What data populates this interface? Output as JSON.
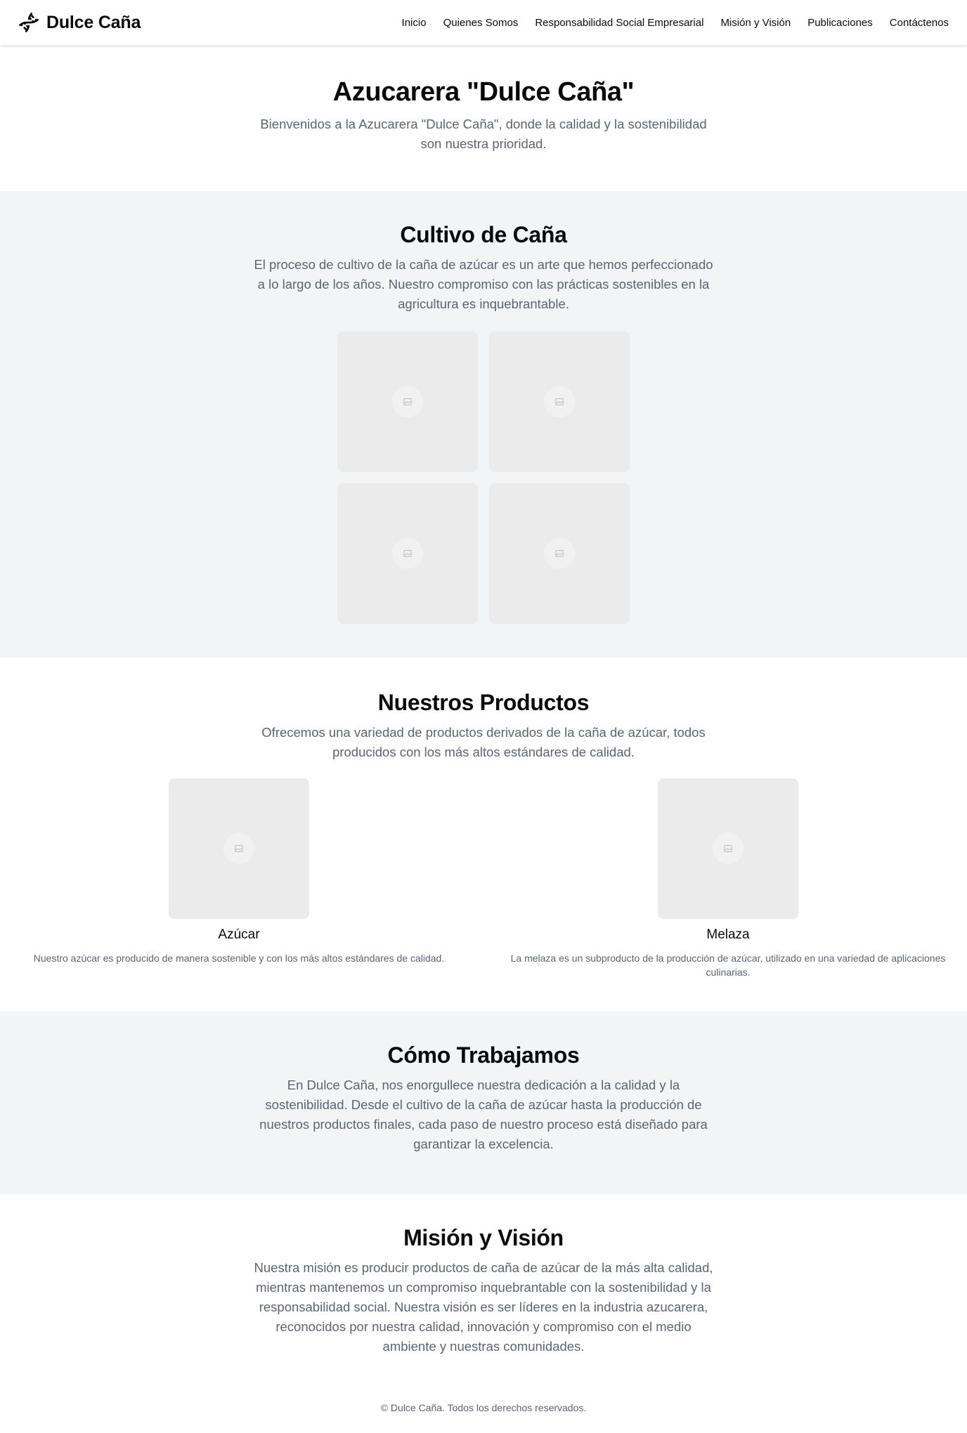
{
  "header": {
    "brand": "Dulce Caña",
    "nav": [
      "Inicio",
      "Quienes Somos",
      "Responsabilidad Social Empresarial",
      "Misión y Visión",
      "Publicaciones",
      "Contáctenos"
    ]
  },
  "hero": {
    "title": "Azucarera \"Dulce Caña\"",
    "text": "Bienvenidos a la Azucarera \"Dulce Caña\", donde la calidad y la sostenibilidad son nuestra prioridad."
  },
  "cultivo": {
    "title": "Cultivo de Caña",
    "text": "El proceso de cultivo de la caña de azúcar es un arte que hemos perfeccionado a lo largo de los años. Nuestro compromiso con las prácticas sostenibles en la agricultura es inquebrantable."
  },
  "productos": {
    "title": "Nuestros Productos",
    "text": "Ofrecemos una variedad de productos derivados de la caña de azúcar, todos producidos con los más altos estándares de calidad.",
    "items": [
      {
        "name": "Azúcar",
        "desc": "Nuestro azúcar es producido de manera sostenible y con los más altos estándares de calidad."
      },
      {
        "name": "Melaza",
        "desc": "La melaza es un subproducto de la producción de azúcar, utilizado en una variedad de aplicaciones culinarias."
      }
    ]
  },
  "trabajo": {
    "title": "Cómo Trabajamos",
    "text": "En Dulce Caña, nos enorgullece nuestra dedicación a la calidad y la sostenibilidad. Desde el cultivo de la caña de azúcar hasta la producción de nuestros productos finales, cada paso de nuestro proceso está diseñado para garantizar la excelencia."
  },
  "mision": {
    "title": "Misión y Visión",
    "text": "Nuestra misión es producir productos de caña de azúcar de la más alta calidad, mientras mantenemos un compromiso inquebrantable con la sostenibilidad y la responsabilidad social. Nuestra visión es ser líderes en la industria azucarera, reconocidos por nuestra calidad, innovación y compromiso con el medio ambiente y nuestras comunidades."
  },
  "footer": {
    "text": "© Dulce Caña. Todos los derechos reservados."
  },
  "icons": {
    "brand": "dna-icon",
    "placeholder": "image-placeholder-icon"
  }
}
